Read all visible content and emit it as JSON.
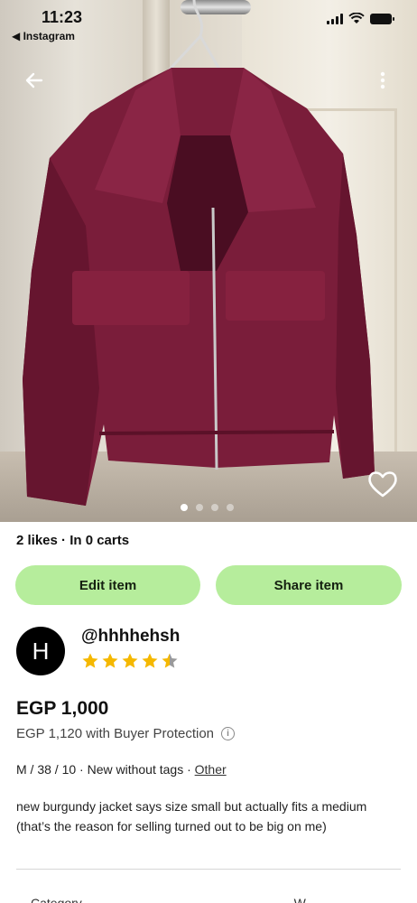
{
  "status_bar": {
    "time": "11:23",
    "back_to_app": "◀ Instagram"
  },
  "gallery": {
    "image_count": 4,
    "active_index": 0
  },
  "listing": {
    "likes_carts": "2 likes · In 0 carts",
    "edit_label": "Edit item",
    "share_label": "Share item",
    "price": "EGP 1,000",
    "price_with_protection": "EGP 1,120 with Buyer Protection",
    "meta_text": "M / 38 / 10 · New without tags · ",
    "meta_link": "Other",
    "description": "new burgundy jacket says size small but actually fits a medium (that’s the reason for selling turned out to be big on me)"
  },
  "seller": {
    "avatar_letter": "H",
    "username": "@hhhhehsh",
    "rating": 4.5
  },
  "details": {
    "category_label": "Category",
    "category_value": "W... ... ... ... ..."
  },
  "colors": {
    "button_green": "#b6ed9c",
    "star": "#f5b800",
    "jacket": "#7a1d3a"
  }
}
